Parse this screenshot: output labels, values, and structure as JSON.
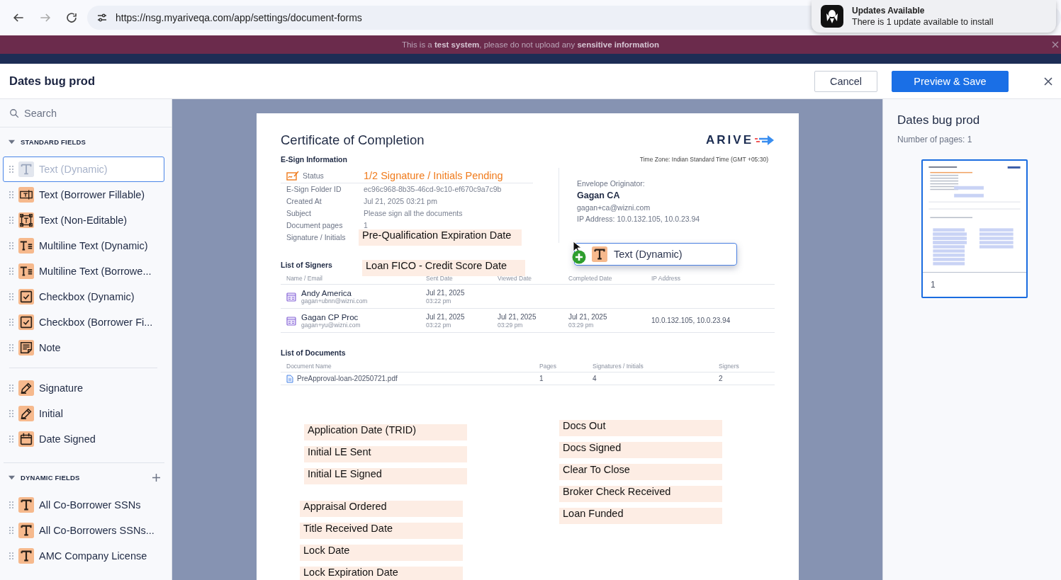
{
  "browser": {
    "url": "https://nsg.myariveqa.com/app/settings/document-forms",
    "notification": {
      "title": "Updates Available",
      "message": "There is 1 update available to install"
    }
  },
  "banner": {
    "text": "This is a **test system**, please do not upload any **sensitive information**"
  },
  "header": {
    "title": "Dates bug prod",
    "buttons": [
      {
        "label": "Cancel",
        "kind": "secondary"
      },
      {
        "label": "Preview & Save",
        "kind": "primary"
      }
    ]
  },
  "sidebar": {
    "search": {
      "placeholder": "Search"
    },
    "sections": [
      {
        "title": "STANDARD FIELDS",
        "expanded": true,
        "addable": false,
        "groups": [
          [
            {
              "label": "Text (Dynamic)",
              "kind": "text",
              "dragging": true
            },
            {
              "label": "Text (Borrower Fillable)",
              "kind": "text-fillable",
              "dragging": false
            },
            {
              "label": "Text (Non-Editable)",
              "kind": "text-framed",
              "dragging": false
            },
            {
              "label": "Multiline Text (Dynamic)",
              "kind": "multiline",
              "dragging": false
            },
            {
              "label": "Multiline Text (Borrowe...",
              "kind": "multiline",
              "dragging": false
            },
            {
              "label": "Checkbox (Dynamic)",
              "kind": "checkbox",
              "dragging": false
            },
            {
              "label": "Checkbox (Borrower Fi...",
              "kind": "checkbox",
              "dragging": false
            },
            {
              "label": "Note",
              "kind": "note",
              "dragging": false
            }
          ],
          [
            {
              "label": "Signature",
              "kind": "signature",
              "dragging": false
            },
            {
              "label": "Initial",
              "kind": "signature",
              "dragging": false
            },
            {
              "label": "Date Signed",
              "kind": "date",
              "dragging": false
            }
          ]
        ]
      },
      {
        "title": "DYNAMIC FIELDS",
        "expanded": true,
        "addable": true,
        "groups": [
          [
            {
              "label": "All Co-Borrower SSNs",
              "kind": "text-bold",
              "dragging": false
            },
            {
              "label": "All Co-Borrowers SSNs...",
              "kind": "text-bold",
              "dragging": false
            },
            {
              "label": "AMC Company License",
              "kind": "text-bold",
              "dragging": false
            }
          ]
        ]
      }
    ]
  },
  "document": {
    "title": "Certificate of Completion",
    "logo": "ARIVE",
    "timezone": "Time Zone: Indian Standard Time (GMT +05:30)",
    "esign": {
      "heading": "E-Sign Information",
      "status_label": "Status",
      "status_value": "1/2 Signature / Initials Pending",
      "rows": [
        {
          "label": "E-Sign Folder ID",
          "value": "ec96c968-8b35-46cd-9c10-ef670c9a7c9b"
        },
        {
          "label": "Created At",
          "value": "Jul 21, 2025 03:21 pm"
        },
        {
          "label": "Subject",
          "value": "Please sign all the documents"
        },
        {
          "label": "Document pages",
          "value": "1"
        },
        {
          "label": "Signature / Initials"
        }
      ]
    },
    "originator": {
      "label": "Envelope Originator:",
      "name": "Gagan CA",
      "email": "gagan+ca@wizni.com",
      "ip": "IP Address: 10.0.132.105, 10.0.23.94"
    },
    "signers": {
      "heading": "List of Signers",
      "columns": [
        "Name / Email",
        "Sent Date",
        "Viewed Date",
        "Completed Date",
        "IP Address"
      ],
      "rows": [
        {
          "name": "Andy America",
          "email": "gagan+ubnn@wizni.com",
          "sent_date": "Jul 21, 2025",
          "sent_time": "03:22 pm"
        },
        {
          "name": "Gagan CP Proc",
          "email": "gagan+yu@wizni.com",
          "sent_date": "Jul 21, 2025",
          "sent_time": "03:22 pm",
          "viewed_date": "Jul 21, 2025",
          "viewed_time": "03:29 pm",
          "completed_date": "Jul 21, 2025",
          "completed_time": "03:29 pm",
          "ip_address": "10.0.132.105, 10.0.23.94"
        }
      ]
    },
    "documents": {
      "heading": "List of Documents",
      "columns": [
        "Document Name",
        "Pages",
        "Signatures / Initials",
        "Signers"
      ],
      "rows": [
        {
          "name": "PreApproval-loan-20250721.pdf",
          "pages": "1",
          "signatures": "4",
          "signers": "2"
        }
      ]
    },
    "placed_fields": [
      {
        "label": "Pre-Qualification Expiration Date"
      },
      {
        "label": "Loan FICO - Credit Score Date"
      },
      {
        "label": "Application Date (TRID)"
      },
      {
        "label": "Initial LE Sent"
      },
      {
        "label": "Initial LE Signed"
      },
      {
        "label": "Appraisal Ordered"
      },
      {
        "label": "Title Received Date"
      },
      {
        "label": "Lock Date"
      },
      {
        "label": "Lock Expiration Date"
      },
      {
        "label": "Docs Out"
      },
      {
        "label": "Docs Signed"
      },
      {
        "label": "Clear To Close"
      },
      {
        "label": "Broker Check Received"
      },
      {
        "label": "Loan Funded"
      }
    ],
    "drag_preview": {
      "label": "Text (Dynamic)"
    }
  },
  "preview": {
    "title": "Dates bug prod",
    "pages": "Number of pages: 1",
    "thumbnails": [
      {
        "page": "1",
        "selected": true
      }
    ]
  }
}
